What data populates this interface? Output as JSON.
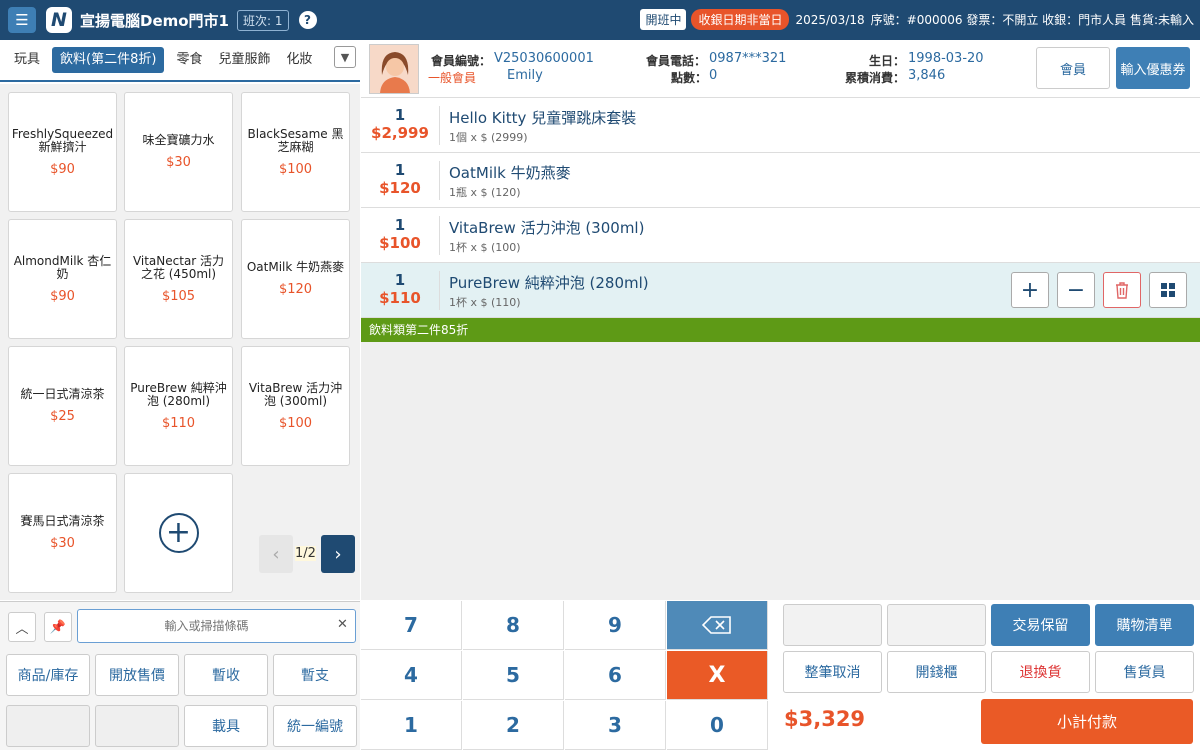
{
  "header": {
    "store_name": "宣揚電腦Demo門市1",
    "shift": "班次: 1",
    "open_badge": "開班中",
    "warning_badge": "收銀日期非當日",
    "date": "2025/03/18",
    "info": "序號：#000006 發票：不開立 收銀：門市人員 售貨:未輸入"
  },
  "categories": [
    "玩具",
    "飲料(第二件8折)",
    "零食",
    "兒童服飾",
    "化妝"
  ],
  "products": [
    {
      "name": "FreshlySqueezed 新鮮擠汁",
      "price": "$90"
    },
    {
      "name": "味全寶礦力水",
      "price": "$30"
    },
    {
      "name": "BlackSesame 黑芝麻糊",
      "price": "$100"
    },
    {
      "name": "AlmondMilk 杏仁奶",
      "price": "$90"
    },
    {
      "name": "VitaNectar 活力之花 (450ml)",
      "price": "$105"
    },
    {
      "name": "OatMilk 牛奶燕麥",
      "price": "$120"
    },
    {
      "name": "統一日式清涼茶",
      "price": "$25"
    },
    {
      "name": "PureBrew 純粹沖泡 (280ml)",
      "price": "$110"
    },
    {
      "name": "VitaBrew 活力沖泡 (300ml)",
      "price": "$100"
    },
    {
      "name": "賽馬日式清涼茶",
      "price": "$30"
    }
  ],
  "pager": {
    "text": "1/2"
  },
  "search": {
    "placeholder": "輸入或掃描條碼"
  },
  "left_buttons": {
    "inventory": "商品/庫存",
    "open_price": "開放售價",
    "temp_receive": "暫收",
    "temp_pay": "暫支",
    "carrier": "載具",
    "tax_id": "統一編號"
  },
  "member": {
    "id_label": "會員編號：",
    "id_value": "V25030600001",
    "tier": "一般會員",
    "name": "Emily",
    "phone_label": "會員電話：",
    "phone_value": "0987***321",
    "points_label": "點數：",
    "points_value": "0",
    "birthday_label": "生日：",
    "birthday_value": "1998-03-20",
    "spend_label": "累積消費：",
    "spend_value": "3,846",
    "member_button": "會員",
    "coupon_button": "輸入優惠券"
  },
  "cart": [
    {
      "qty": "1",
      "price": "$2,999",
      "name": "Hello Kitty 兒童彈跳床套裝",
      "detail": "1個 x $ (2999)"
    },
    {
      "qty": "1",
      "price": "$120",
      "name": "OatMilk 牛奶燕麥",
      "detail": "1瓶 x $ (120)"
    },
    {
      "qty": "1",
      "price": "$100",
      "name": "VitaBrew 活力沖泡 (300ml)",
      "detail": "1杯 x $ (100)"
    },
    {
      "qty": "1",
      "price": "$110",
      "name": "PureBrew 純粹沖泡 (280ml)",
      "detail": "1杯 x $ (110)"
    }
  ],
  "promo": "飲料類第二件85折",
  "keypad": {
    "k7": "7",
    "k8": "8",
    "k9": "9",
    "k4": "4",
    "k5": "5",
    "k6": "6",
    "cancel": "X",
    "k1": "1",
    "k2": "2",
    "k3": "3",
    "k0": "0"
  },
  "functions": {
    "hold": "交易保留",
    "cart_list": "購物清單",
    "void_all": "整筆取消",
    "open_drawer": "開錢櫃",
    "return": "退換貨",
    "salesperson": "售貨員",
    "total": "$3,329",
    "pay": "小計付款"
  },
  "colors": {
    "primary": "#1f4a72",
    "accent": "#e8542a",
    "promo": "#5e9a16"
  }
}
